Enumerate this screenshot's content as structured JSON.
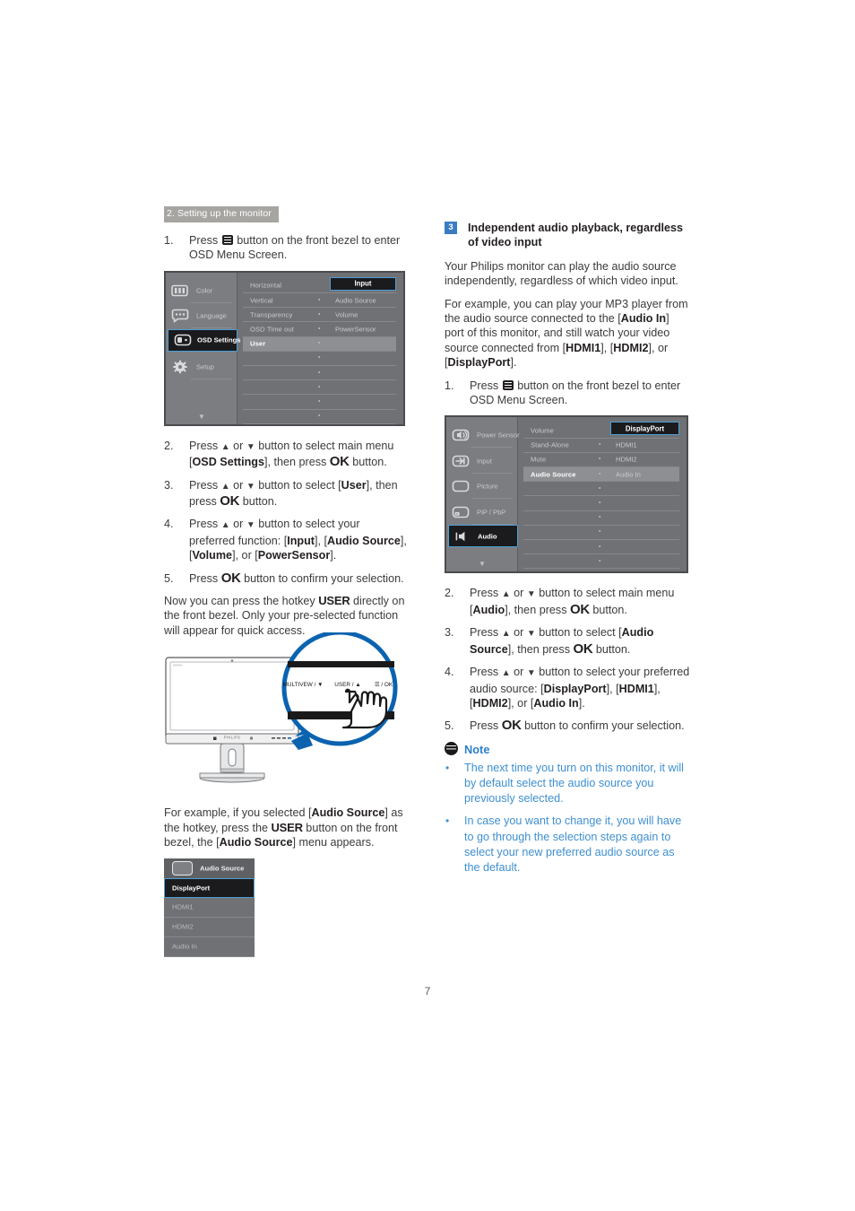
{
  "page": {
    "number": "7",
    "banner": "2. Setting up the monitor"
  },
  "left": {
    "step1": {
      "num": "1.",
      "text_before": "Press",
      "text_after": "button on the front bezel to enter OSD Menu Screen."
    },
    "osd_menu": {
      "sidebar": [
        {
          "label": "Color",
          "icon": "color-bars-icon",
          "active": false
        },
        {
          "label": "Language",
          "icon": "speech-bubble-icon",
          "active": false
        },
        {
          "label": "OSD Settings",
          "icon": "osd-panel-icon",
          "active": true
        },
        {
          "label": "Setup",
          "icon": "gear-icon",
          "active": false
        }
      ],
      "scroll_caret": "▼",
      "middle_column": [
        "Horizontal",
        "Vertical",
        "Transparency",
        "OSD Time out",
        "User"
      ],
      "middle_selected": "User",
      "right_column": [
        "Input",
        "Audio Source",
        "Volume",
        "PowerSensor"
      ],
      "right_selected": "Input"
    },
    "steps": [
      {
        "num": "2.",
        "parts": [
          {
            "t": "Press "
          },
          {
            "t": "▲",
            "s": "arrow"
          },
          {
            "t": " or "
          },
          {
            "t": "▼",
            "s": "arrow"
          },
          {
            "t": " button to select main menu ["
          },
          {
            "t": "OSD Settings",
            "s": "b"
          },
          {
            "t": "], then press "
          },
          {
            "t": "OK",
            "s": "ok"
          },
          {
            "t": " button."
          }
        ]
      },
      {
        "num": "3.",
        "parts": [
          {
            "t": "Press "
          },
          {
            "t": "▲",
            "s": "arrow"
          },
          {
            "t": " or "
          },
          {
            "t": "▼",
            "s": "arrow"
          },
          {
            "t": " button to select ["
          },
          {
            "t": "User",
            "s": "b"
          },
          {
            "t": "], then press "
          },
          {
            "t": "OK",
            "s": "ok"
          },
          {
            "t": " button."
          }
        ]
      },
      {
        "num": "4.",
        "parts": [
          {
            "t": "Press "
          },
          {
            "t": "▲",
            "s": "arrow"
          },
          {
            "t": " or "
          },
          {
            "t": "▼",
            "s": "arrow"
          },
          {
            "t": " button to select your preferred function: ["
          },
          {
            "t": "Input",
            "s": "b"
          },
          {
            "t": "], ["
          },
          {
            "t": "Audio Source",
            "s": "b"
          },
          {
            "t": "], ["
          },
          {
            "t": "Volume",
            "s": "b"
          },
          {
            "t": "], or ["
          },
          {
            "t": "PowerSensor",
            "s": "b"
          },
          {
            "t": "]."
          }
        ]
      },
      {
        "num": "5.",
        "parts": [
          {
            "t": "Press "
          },
          {
            "t": "OK",
            "s": "ok"
          },
          {
            "t": " button to confirm your selection."
          }
        ]
      }
    ],
    "hotkey_para": {
      "p1": "Now you can press the hotkey ",
      "userkey": "USER",
      "p2": " directly on the front bezel. Only your pre-selected function will appear for quick access."
    },
    "illustration": {
      "button_labels": [
        "MULTIVEW / ▼",
        "USER / ▲",
        "☰ / OK"
      ],
      "brand": "PHILIPS"
    },
    "example_para": {
      "p1": "For example, if you selected [",
      "b1": "Audio Source",
      "p2": "] as the hotkey, press the ",
      "userkey": "USER",
      "p3": " button on the front bezel, the [",
      "b2": "Audio Source",
      "p4": "] menu appears."
    },
    "hotkey_menu": {
      "title": "Audio Source",
      "title_icon": "audio-source-icon",
      "items": [
        "DisplayPort",
        "HDMI1",
        "HDMI2",
        "Audio In"
      ],
      "selected": "DisplayPort"
    }
  },
  "right": {
    "heading": {
      "badge": "3",
      "text": "Independent audio playback, regardless of video input"
    },
    "para1": "Your Philips monitor can play the audio source independently, regardless of which video input.",
    "para2": {
      "p1": "For example, you can play your MP3 player from the audio source connected to the [",
      "b1": "Audio In",
      "p2": "] port of this monitor, and still watch your video source connected from [",
      "b2": "HDMI1",
      "p3": "], [",
      "b3": "HDMI2",
      "p4": "], or [",
      "b4": "DisplayPort",
      "p5": "]."
    },
    "step1": {
      "num": "1.",
      "text_before": "Press",
      "text_after": "button on the front bezel to enter OSD Menu Screen."
    },
    "osd_menu": {
      "sidebar": [
        {
          "label": "Power Sensor",
          "icon": "power-sensor-icon",
          "active": false
        },
        {
          "label": "Input",
          "icon": "input-arrow-icon",
          "active": false
        },
        {
          "label": "Picture",
          "icon": "picture-icon",
          "active": false
        },
        {
          "label": "PiP / PbP",
          "icon": "pip-pbp-icon",
          "active": false
        },
        {
          "label": "Audio",
          "icon": "speaker-icon",
          "active": true
        }
      ],
      "scroll_caret": "▼",
      "middle_column": [
        "Volume",
        "Stand-Alone",
        "Mute",
        "Audio Source"
      ],
      "middle_selected": "Audio Source",
      "right_column": [
        "DisplayPort",
        "HDMI1",
        "HDMI2",
        "Audio In"
      ],
      "right_selected": "DisplayPort"
    },
    "steps": [
      {
        "num": "2.",
        "parts": [
          {
            "t": "Press "
          },
          {
            "t": "▲",
            "s": "arrow"
          },
          {
            "t": " or "
          },
          {
            "t": "▼",
            "s": "arrow"
          },
          {
            "t": " button to select main menu ["
          },
          {
            "t": "Audio",
            "s": "b"
          },
          {
            "t": "], then press "
          },
          {
            "t": "OK",
            "s": "ok"
          },
          {
            "t": " button."
          }
        ]
      },
      {
        "num": "3.",
        "parts": [
          {
            "t": "Press "
          },
          {
            "t": "▲",
            "s": "arrow"
          },
          {
            "t": " or "
          },
          {
            "t": "▼",
            "s": "arrow"
          },
          {
            "t": " button to select ["
          },
          {
            "t": "Audio Source",
            "s": "b"
          },
          {
            "t": "], then press "
          },
          {
            "t": "OK",
            "s": "ok"
          },
          {
            "t": " button."
          }
        ]
      },
      {
        "num": "4.",
        "parts": [
          {
            "t": "Press "
          },
          {
            "t": "▲",
            "s": "arrow"
          },
          {
            "t": " or "
          },
          {
            "t": "▼",
            "s": "arrow"
          },
          {
            "t": " button to select your preferred audio source: ["
          },
          {
            "t": "DisplayPort",
            "s": "b"
          },
          {
            "t": "], ["
          },
          {
            "t": "HDMI1",
            "s": "b"
          },
          {
            "t": "], ["
          },
          {
            "t": "HDMI2",
            "s": "b"
          },
          {
            "t": "], or ["
          },
          {
            "t": "Audio In",
            "s": "b"
          },
          {
            "t": "]."
          }
        ]
      },
      {
        "num": "5.",
        "parts": [
          {
            "t": "Press "
          },
          {
            "t": "OK",
            "s": "ok"
          },
          {
            "t": " button to confirm your selection."
          }
        ]
      }
    ],
    "note": {
      "title": "Note",
      "icon": "note-icon",
      "bullets": [
        "The next time you turn on this monitor, it will by default select the audio source you previously selected.",
        "In case you want to change it, you will have to go through the selection steps again to select your new preferred audio source as the default."
      ]
    }
  },
  "colors": {
    "banner_bg": "#a7a5a2",
    "badge_blue": "#3a7bc2",
    "note_blue": "#3e8fd0",
    "osd_bg": "#6f7174",
    "osd_highlight": "#4e9fd8",
    "illustration_blue": "#0b63b0",
    "body_text": "#3b3b3d"
  }
}
